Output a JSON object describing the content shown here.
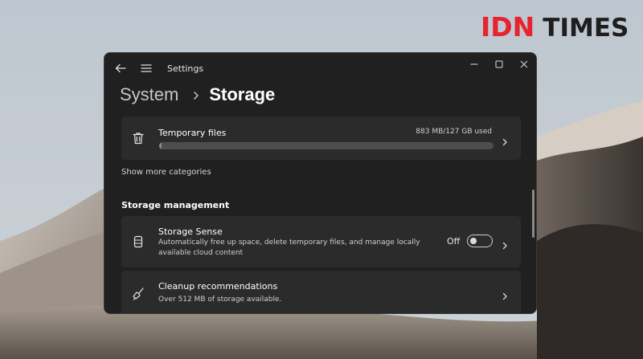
{
  "watermark": {
    "part1": "IDN",
    "part2": "TIMES",
    "colors": {
      "accent": "#e8222e",
      "dark": "#1e1e1e"
    }
  },
  "window": {
    "title": "Settings",
    "caption_icons": [
      "minimize-icon",
      "maximize-icon",
      "close-icon"
    ]
  },
  "breadcrumb": {
    "parent": "System",
    "current": "Storage"
  },
  "temporary_files": {
    "label": "Temporary files",
    "usage": "883 MB/127 GB used",
    "usage_fraction": 0.007,
    "icon": "trash-icon"
  },
  "show_more": "Show more categories",
  "storage_management": {
    "title": "Storage management",
    "storage_sense": {
      "label": "Storage Sense",
      "description": "Automatically free up space, delete temporary files, and manage locally available cloud content",
      "toggle_state": "Off",
      "icon": "drive-icon"
    },
    "cleanup": {
      "label": "Cleanup recommendations",
      "description": "Over 512 MB of storage available.",
      "icon": "broom-icon"
    }
  },
  "theme": {
    "window_bg": "#202020",
    "card_bg": "#2b2b2b",
    "text": "#ffffff"
  }
}
